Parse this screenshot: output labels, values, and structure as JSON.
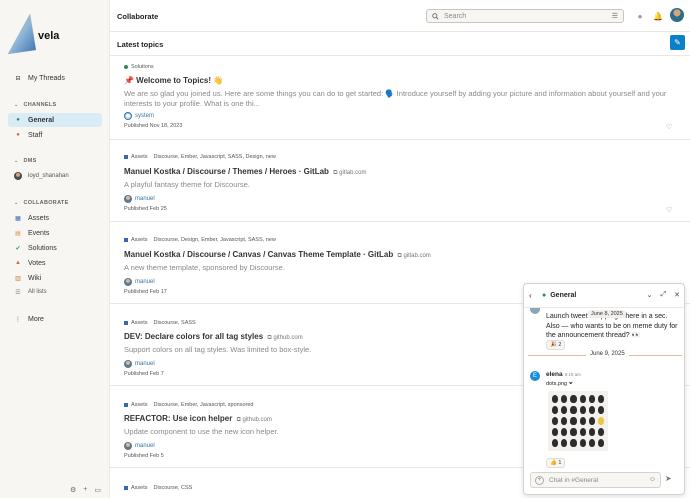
{
  "brand": {
    "name": "vela"
  },
  "sidebar": {
    "my_threads": "My Threads",
    "channels_heading": "CHANNELS",
    "channels": [
      {
        "label": "General",
        "active": true,
        "color": "#2e8b57"
      },
      {
        "label": "Staff",
        "active": false,
        "color": "#d9623a"
      }
    ],
    "dms_heading": "DMS",
    "dms": [
      {
        "label": "loyd_shanahan"
      }
    ],
    "collaborate_heading": "COLLABORATE",
    "collaborate": [
      {
        "label": "Assets",
        "color": "#3b66b3"
      },
      {
        "label": "Events",
        "color": "#e08a3a"
      },
      {
        "label": "Solutions",
        "color": "#2e9e4f"
      },
      {
        "label": "Votes",
        "color": "#d9623a"
      },
      {
        "label": "Wiki",
        "color": "#c07a2a"
      },
      {
        "label": "All lists",
        "color": "#888888"
      }
    ],
    "more": "More"
  },
  "header": {
    "title": "Collaborate",
    "search_placeholder": "Search"
  },
  "main": {
    "subheader": "Latest topics"
  },
  "topics": [
    {
      "category": "Solutions",
      "title": "📌 Welcome to Topics! 👋",
      "excerpt": "We are so glad you joined us. Here are some things you can do to get started: 🗣️ Introduce yourself by adding your picture and information about yourself and your interests to your profile. What is one thi...",
      "author": "system",
      "published": "Published Nov 18, 2023"
    },
    {
      "category": "Assets",
      "tags": "Discourse, Ember, Javascript, SASS, Design, new",
      "title": "Manuel Kostka / Discourse / Themes / Heroes · GitLab",
      "link": "gitlab.com",
      "excerpt": "A playful fantasy theme for Discourse.",
      "author": "manuel",
      "published": "Published Feb 25"
    },
    {
      "category": "Assets",
      "tags": "Discourse, Design, Ember, Javascript, SASS, new",
      "title": "Manuel Kostka / Discourse / Canvas / Canvas Theme Template · GitLab",
      "link": "gitlab.com",
      "excerpt": "A new theme template, sponsored by Discourse.",
      "author": "manuel",
      "published": "Published Feb 17"
    },
    {
      "category": "Assets",
      "tags": "Discourse, SASS",
      "title": "DEV: Declare colors for all tag styles",
      "link": "github.com",
      "excerpt": "Support colors on all tag styles. Was limited to box-style.",
      "author": "manuel",
      "published": "Published Feb 7"
    },
    {
      "category": "Assets",
      "tags": "Discourse, Ember, Javascript, sponsored",
      "title": "REFACTOR: Use icon helper",
      "link": "github.com",
      "excerpt": "Update component to use the new icon helper.",
      "author": "manuel",
      "published": "Published Feb 5"
    },
    {
      "category": "Assets",
      "tags": "Discourse, CSS"
    }
  ],
  "chat": {
    "channel": "General",
    "msg1_text": "Launch tweet  Dropping it here in a sec. Also — who wants to be on meme duty for the announcement thread? 👀",
    "msg1_date_pill": "June 8, 2025",
    "msg1_reaction": "🎉 2",
    "date_divider": "June 9, 2025",
    "msg2_author": "elena",
    "msg2_time": "9:19 am",
    "msg2_file": "dots.png",
    "msg2_reaction": "👍 1",
    "input_placeholder": "Chat in #General"
  }
}
